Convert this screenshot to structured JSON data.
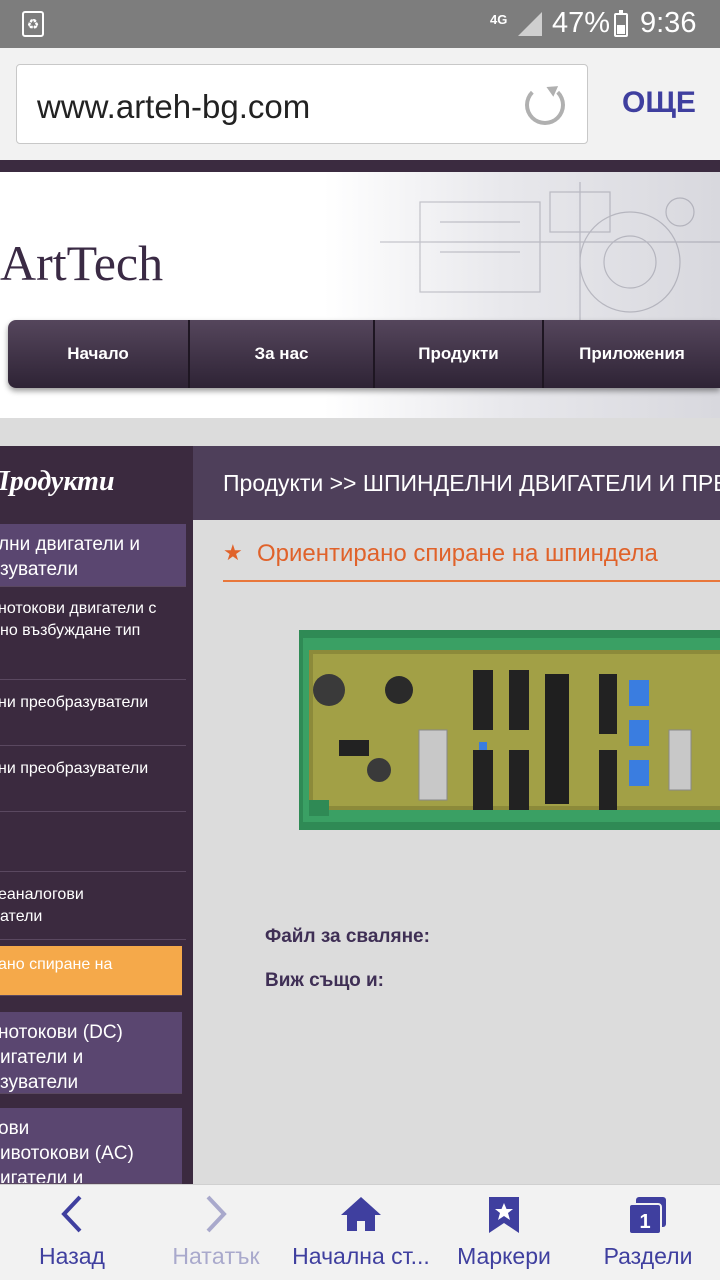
{
  "status_bar": {
    "network": "4G",
    "battery_percent": "47%",
    "battery_level": 0.47,
    "time": "9:36",
    "icons": [
      "recycle-icon",
      "signal-icon",
      "battery-icon"
    ]
  },
  "browser": {
    "url": "www.arteh-bg.com",
    "more_label": "ОЩЕ"
  },
  "site": {
    "logo": "ArtTech",
    "nav": [
      "Начало",
      "За нас",
      "Продукти",
      "Приложения"
    ],
    "sidebar_title": "Продукти",
    "sidebar_items": [
      "лни двигатели и\nзуватели",
      "нотокови двигатели с\nно възбуждане тип",
      "ни преобразуватели",
      "ни преобразуватели",
      "",
      "еаналогови\nатели",
      "ано спиране на",
      "нотокови (DC)\nигатели и\nзуватели",
      "ови\nивотокови (AC)\nигатели и"
    ],
    "breadcrumb": "Продукти >> ШПИНДЕЛНИ ДВИГАТЕЛИ И ПРЕОБРАЗУВАТЕЛИ",
    "page_title": "Ориентирано спиране на шпиндела",
    "file_label": "Файл за сваляне:",
    "see_also_label": "Виж също и:",
    "accent_color": "#e0622a",
    "active_item_color": "#f5a94a"
  },
  "bottom_nav": {
    "back": "Назад",
    "forward": "Натaтък",
    "home": "Начална ст...",
    "bookmarks": "Маркери",
    "tabs": "Раздели",
    "tab_count": "1"
  }
}
